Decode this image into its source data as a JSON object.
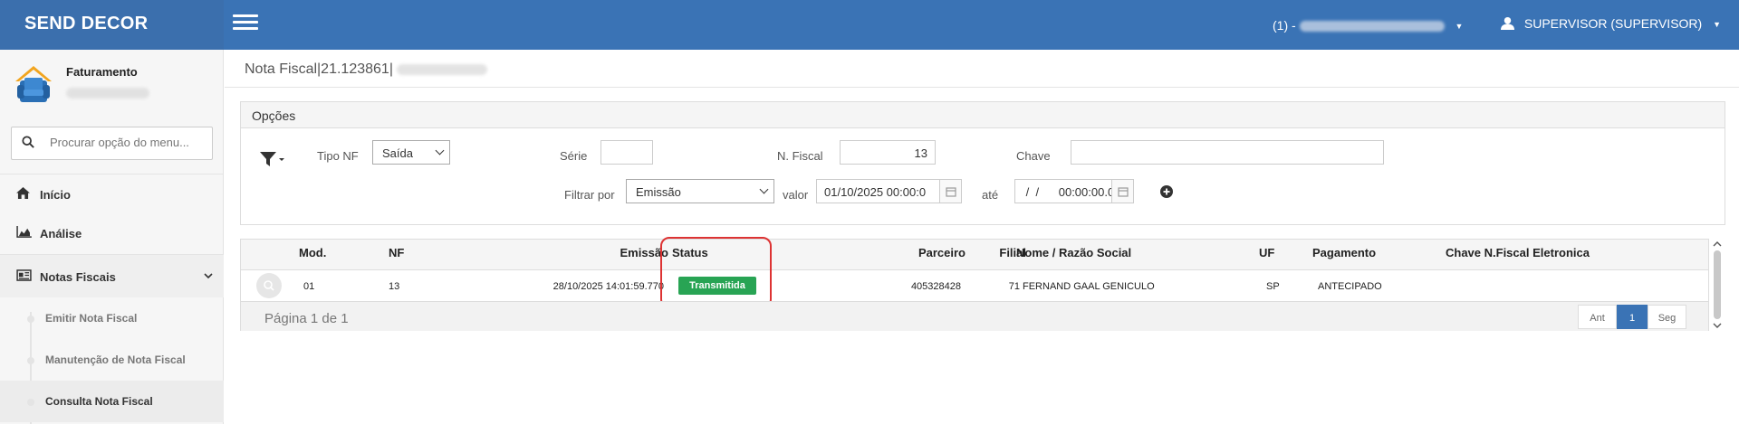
{
  "topbar": {
    "brand": "SEND DECOR",
    "store_prefix": "(1) -",
    "user_label": "SUPERVISOR (SUPERVISOR)",
    "brand_color": "#3a73b5"
  },
  "sidebar": {
    "app_title": "Faturamento",
    "search_placeholder": "Procurar opção do menu...",
    "items": [
      {
        "label": "Início",
        "icon": "home-icon"
      },
      {
        "label": "Análise",
        "icon": "area-chart-icon"
      },
      {
        "label": "Notas Fiscais",
        "icon": "invoice-icon"
      }
    ],
    "subitems": [
      {
        "label": "Emitir Nota Fiscal"
      },
      {
        "label": "Manutenção de Nota Fiscal"
      },
      {
        "label": "Consulta Nota Fiscal"
      }
    ]
  },
  "page": {
    "title": "Nota Fiscal|21.123861|"
  },
  "options": {
    "header": "Opções",
    "tipo_nf_label": "Tipo NF",
    "tipo_nf_value": "Saída",
    "serie_label": "Série",
    "serie_value": "",
    "nfiscal_label": "N. Fiscal",
    "nfiscal_value": "13",
    "chave_label": "Chave",
    "chave_value": "",
    "filtrar_label": "Filtrar por",
    "filtrar_value": "Emissão",
    "valor_label": "valor",
    "valor_value": "01/10/2025 00:00:0",
    "ate_label": "até",
    "ate_value": " /  /      00:00:00.0"
  },
  "grid": {
    "columns": [
      "Mod.",
      "NF",
      "Emissão",
      "Status",
      "Parceiro",
      "Filial",
      "Nome / Razão Social",
      "UF",
      "Pagamento",
      "Chave N.Fiscal Eletronica"
    ],
    "rows": [
      {
        "mod": "01",
        "nf": "13",
        "emissao": "28/10/2025 14:01:59.770",
        "status": "Transmitida",
        "parceiro": "405328428",
        "filial": "71",
        "nome": "FERNAND GAAL GENICULO",
        "uf": "SP",
        "pagamento": "ANTECIPADO",
        "chave": ""
      }
    ],
    "page_info": "Página 1 de 1",
    "pager": {
      "prev": "Ant",
      "current": "1",
      "next": "Seg"
    },
    "status_color": "#28a454"
  }
}
